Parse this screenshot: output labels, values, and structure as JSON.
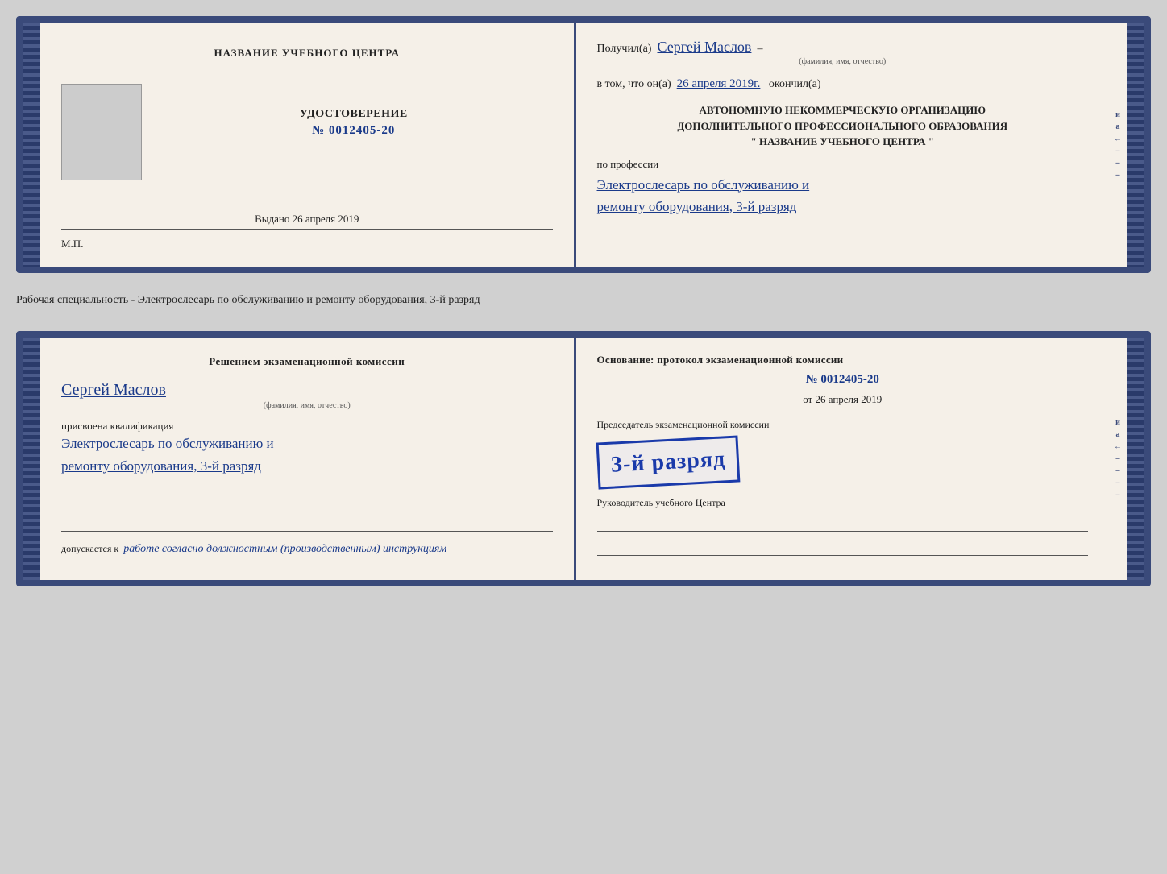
{
  "top_doc": {
    "left": {
      "org_name": "НАЗВАНИЕ УЧЕБНОГО ЦЕНТРА",
      "cert_title": "УДОСТОВЕРЕНИЕ",
      "cert_number_label": "№",
      "cert_number": "0012405-20",
      "issued_label": "Выдано",
      "issued_date": "26 апреля 2019",
      "mp_label": "М.П."
    },
    "right": {
      "received_prefix": "Получил(а)",
      "recipient_name": "Сергей Маслов",
      "recipient_label": "(фамилия, имя, отчество)",
      "date_prefix": "в том, что он(а)",
      "event_date": "26 апреля 2019г.",
      "date_suffix": "окончил(а)",
      "org_line1": "АВТОНОМНУЮ НЕКОММЕРЧЕСКУЮ ОРГАНИЗАЦИЮ",
      "org_line2": "ДОПОЛНИТЕЛЬНОГО ПРОФЕССИОНАЛЬНОГО ОБРАЗОВАНИЯ",
      "org_line3": "\" НАЗВАНИЕ УЧЕБНОГО ЦЕНТРА \"",
      "profession_prefix": "по профессии",
      "profession_line1": "Электрослесарь по обслуживанию и",
      "profession_line2": "ремонту оборудования, 3-й разряд"
    }
  },
  "middle_text": "Рабочая специальность - Электрослесарь по обслуживанию и ремонту оборудования, 3-й разряд",
  "bottom_doc": {
    "left": {
      "commission_heading": "Решением экзаменационной комиссии",
      "person_name": "Сергей Маслов",
      "person_label": "(фамилия, имя, отчество)",
      "qualification_prefix": "присвоена квалификация",
      "qual_line1": "Электрослесарь по обслуживанию и",
      "qual_line2": "ремонту оборудования, 3-й разряд",
      "allow_prefix": "допускается к",
      "allow_text": "работе согласно должностным (производственным) инструкциям"
    },
    "right": {
      "basis_text": "Основание: протокол экзаменационной комиссии",
      "protocol_num_label": "№",
      "protocol_num": "0012405-20",
      "date_prefix": "от",
      "protocol_date": "26 апреля 2019",
      "commission_role": "Председатель экзаменационной комиссии",
      "stamp_line1": "3-й разряд",
      "stamp_big": "3-й разряд",
      "leader_role": "Руководитель учебного Центра"
    }
  },
  "side_chars": [
    "и",
    "а",
    "←",
    "–",
    "–",
    "–",
    "–"
  ],
  "stamp_text": "3-й разряд"
}
